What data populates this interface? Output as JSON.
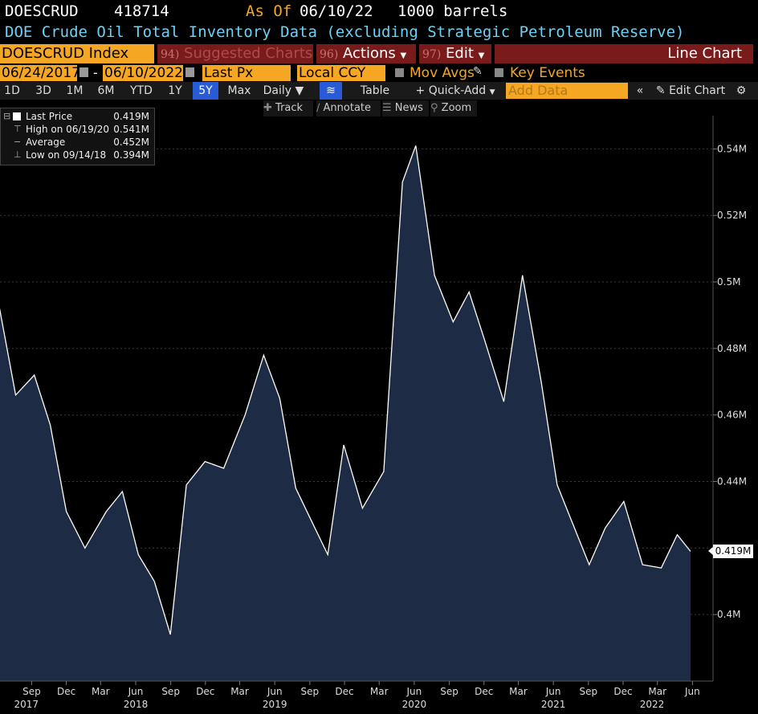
{
  "header": {
    "ticker": "DOESCRUD",
    "last_value": "418714",
    "as_of_label": "As Of",
    "as_of_date": "06/10/22",
    "units": "1000 barrels",
    "description": "DOE Crude Oil Total Inventory Data (excluding Strategic Petroleum Reserve)"
  },
  "toolbar": {
    "security": "DOESCRUD Index",
    "suggested_num": "94)",
    "suggested_label": "Suggested Charts",
    "actions_num": "96)",
    "actions_label": "Actions",
    "edit_num": "97)",
    "edit_label": "Edit",
    "chart_type": "Line Chart",
    "start_date": "06/24/2017",
    "end_date": "06/10/2022",
    "range_separator": "-",
    "field": "Last Px",
    "currency": "Local CCY",
    "mov_avgs": "Mov Avgs",
    "key_events": "Key Events",
    "ranges": [
      "1D",
      "3D",
      "1M",
      "6M",
      "YTD",
      "1Y",
      "5Y",
      "Max"
    ],
    "selected_range": "5Y",
    "periodicity": "Daily",
    "table_label": "Table",
    "quick_add": "Quick-Add",
    "add_data_placeholder": "Add Data",
    "edit_chart": "Edit Chart",
    "track": "Track",
    "annotate": "Annotate",
    "news": "News",
    "zoom": "Zoom"
  },
  "legend": {
    "last_price_label": "Last Price",
    "last_price_value": "0.419M",
    "high_label": "High on 06/19/20",
    "high_value": "0.541M",
    "average_label": "Average",
    "average_value": "0.452M",
    "low_label": "Low on 09/14/18",
    "low_value": "0.394M"
  },
  "colors": {
    "accent": "#f5a623",
    "line": "#ffffff",
    "fill": "#1d2b45",
    "background": "#000000"
  },
  "chart_data": {
    "type": "area",
    "series_name": "Last Price",
    "x_range": [
      "2017-06-24",
      "2022-06-10"
    ],
    "ylim": [
      0.38,
      0.55
    ],
    "y_ticks": [
      0.4,
      0.42,
      0.44,
      0.46,
      0.48,
      0.5,
      0.52,
      0.54
    ],
    "y_tick_labels": [
      "0.4M",
      "",
      "0.44M",
      "0.46M",
      "0.48M",
      "0.5M",
      "0.52M",
      "0.54M"
    ],
    "last_label": "0.419M",
    "x_month_labels": [
      "Sep",
      "Dec",
      "Mar",
      "Jun",
      "Sep",
      "Dec",
      "Mar",
      "Jun",
      "Sep",
      "Dec",
      "Mar",
      "Jun",
      "Sep",
      "Dec",
      "Mar",
      "Jun",
      "Sep",
      "Dec",
      "Mar",
      "Jun"
    ],
    "x_years": [
      "2017",
      "2018",
      "2019",
      "2020",
      "2021",
      "2022"
    ],
    "x": [
      "2017-06-23",
      "2017-08-04",
      "2017-09-22",
      "2017-11-03",
      "2017-12-15",
      "2018-02-02",
      "2018-03-30",
      "2018-05-11",
      "2018-06-22",
      "2018-08-03",
      "2018-09-14",
      "2018-10-26",
      "2018-12-14",
      "2019-02-01",
      "2019-03-29",
      "2019-05-17",
      "2019-06-28",
      "2019-08-09",
      "2019-09-20",
      "2019-11-01",
      "2019-12-13",
      "2020-01-31",
      "2020-03-27",
      "2020-05-15",
      "2020-06-19",
      "2020-08-07",
      "2020-09-25",
      "2020-11-06",
      "2020-12-18",
      "2021-02-05",
      "2021-03-26",
      "2021-05-14",
      "2021-06-25",
      "2021-08-06",
      "2021-09-17",
      "2021-10-29",
      "2021-12-17",
      "2022-02-04",
      "2022-03-25",
      "2022-05-06",
      "2022-06-10"
    ],
    "values": [
      0.492,
      0.466,
      0.472,
      0.457,
      0.431,
      0.42,
      0.431,
      0.437,
      0.418,
      0.41,
      0.394,
      0.439,
      0.446,
      0.444,
      0.46,
      0.478,
      0.465,
      0.438,
      0.428,
      0.418,
      0.451,
      0.432,
      0.443,
      0.53,
      0.541,
      0.502,
      0.488,
      0.497,
      0.482,
      0.464,
      0.502,
      0.47,
      0.439,
      0.427,
      0.415,
      0.426,
      0.434,
      0.415,
      0.414,
      0.424,
      0.419
    ]
  }
}
